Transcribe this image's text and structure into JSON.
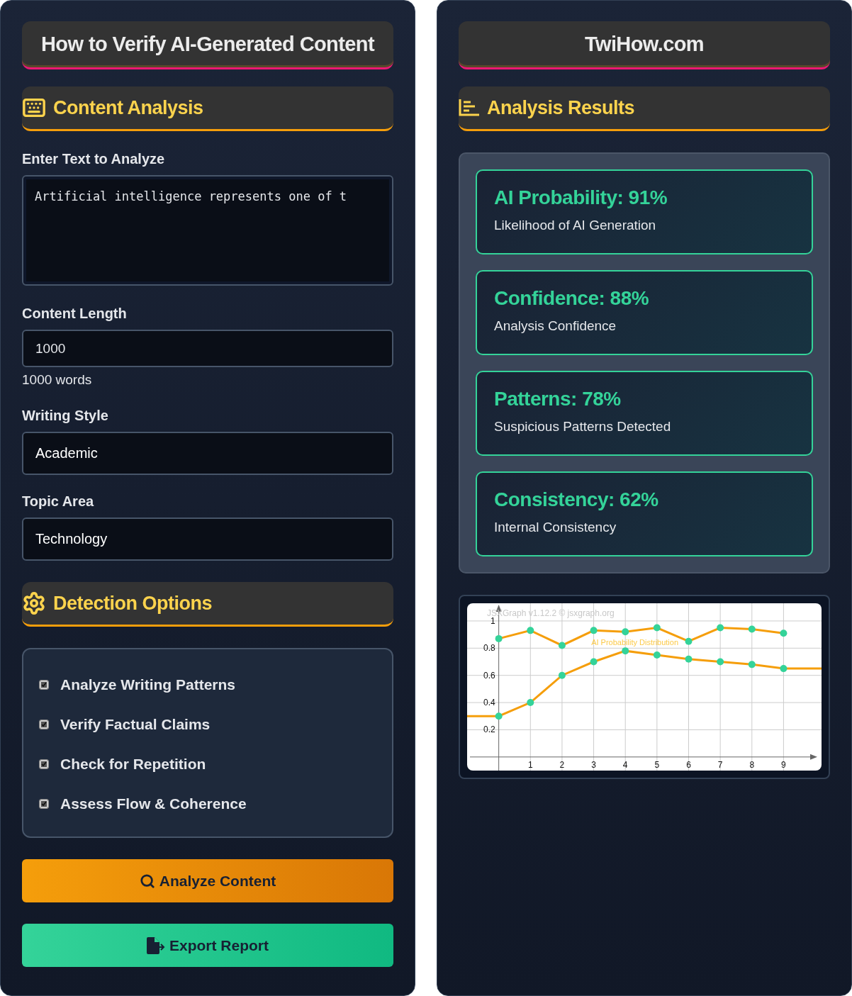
{
  "left_panel": {
    "title_banner": "How to Verify AI-Generated Content",
    "content_section": {
      "heading": "Content Analysis",
      "text_field": {
        "label": "Enter Text to Analyze",
        "value": "Artificial intelligence represents one of t"
      },
      "length_field": {
        "label": "Content Length",
        "value": "1000",
        "hint": "1000 words"
      },
      "style_field": {
        "label": "Writing Style",
        "value": "Academic"
      },
      "topic_field": {
        "label": "Topic Area",
        "value": "Technology"
      }
    },
    "options_section": {
      "heading": "Detection Options",
      "options": [
        {
          "label": "Analyze Writing Patterns",
          "checked": true
        },
        {
          "label": "Verify Factual Claims",
          "checked": true
        },
        {
          "label": "Check for Repetition",
          "checked": true
        },
        {
          "label": "Assess Flow & Coherence",
          "checked": true
        }
      ]
    },
    "buttons": [
      {
        "label": "Analyze Content",
        "kind": "analyze"
      },
      {
        "label": "Export Report",
        "kind": "export"
      }
    ]
  },
  "right_panel": {
    "title_banner": "TwiHow.com",
    "results_heading": "Analysis Results",
    "results": [
      {
        "title": "AI Probability: 91%",
        "subtitle": "Likelihood of AI Generation"
      },
      {
        "title": "Confidence: 88%",
        "subtitle": "Analysis Confidence"
      },
      {
        "title": "Patterns: 78%",
        "subtitle": "Suspicious Patterns Detected"
      },
      {
        "title": "Consistency: 62%",
        "subtitle": "Internal Consistency"
      }
    ],
    "chart": {
      "credit": "JSXGraph v1.12.2 © jsxgraph.org",
      "chart_data": {
        "type": "line",
        "title": "AI Probability Distribution",
        "grid": true,
        "x": [
          -1,
          0,
          1,
          2,
          3,
          4,
          5,
          6,
          7,
          8,
          9,
          10.2
        ],
        "xlim": [
          -1,
          10.2
        ],
        "ylim": [
          -0.1,
          1.13
        ],
        "xticks": [
          1,
          2,
          3,
          4,
          5,
          6,
          7,
          8,
          9
        ],
        "yticks": [
          0.2,
          0.4,
          0.6,
          0.8,
          1
        ],
        "series": [
          {
            "color": "#f59e0b",
            "marker": "circle",
            "values": [
              null,
              0.87,
              0.93,
              0.82,
              0.93,
              0.92,
              0.95,
              0.85,
              0.95,
              0.94,
              0.91,
              null
            ]
          },
          {
            "color": "#f59e0b",
            "marker": "circle",
            "values": [
              0.3,
              0.3,
              0.4,
              0.6,
              0.7,
              0.78,
              0.75,
              0.72,
              0.7,
              0.68,
              0.65,
              0.65
            ]
          }
        ]
      }
    }
  }
}
